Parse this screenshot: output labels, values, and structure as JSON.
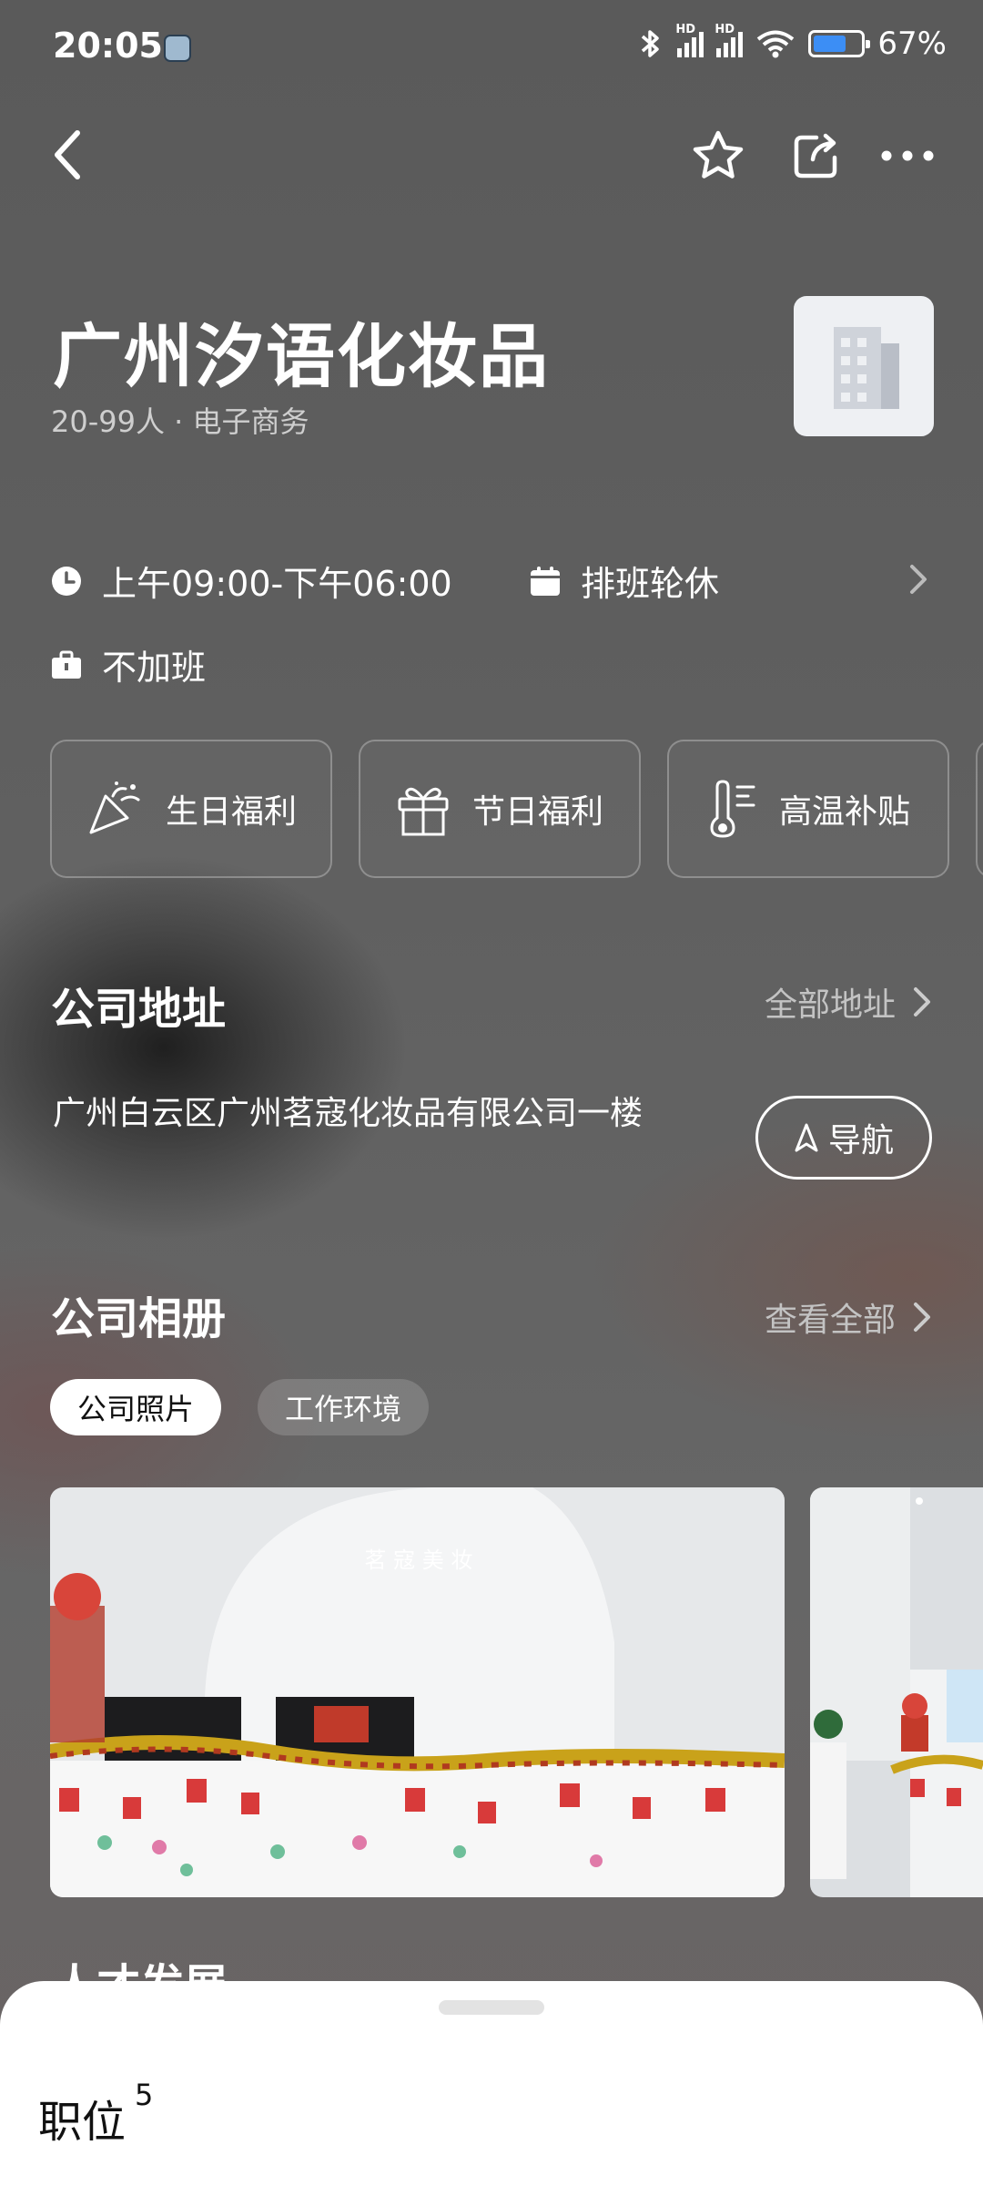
{
  "status_bar": {
    "time": "20:05",
    "battery": "67%",
    "battery_level": 0.67,
    "icons": [
      "alarm-app-icon",
      "bluetooth-icon",
      "signal-hd-icon",
      "signal-hd-icon",
      "wifi-icon",
      "battery-icon"
    ]
  },
  "header": {
    "back_icon": "chevron-left-icon",
    "actions": [
      "star-icon",
      "share-icon",
      "more-icon"
    ]
  },
  "company": {
    "name": "广州汐语化妆品",
    "meta": "20-99人 · 电子商务",
    "logo_icon": "building-icon"
  },
  "work_info": {
    "hours": "上午09:00-下午06:00",
    "schedule": "排班轮休",
    "overtime": "不加班"
  },
  "benefits": [
    {
      "label": "生日福利",
      "icon": "party-popper-icon"
    },
    {
      "label": "节日福利",
      "icon": "gift-icon"
    },
    {
      "label": "高温补贴",
      "icon": "thermometer-icon"
    }
  ],
  "address_section": {
    "title": "公司地址",
    "link": "全部地址",
    "address": "广州白云区广州茗寇化妆品有限公司一楼",
    "nav_button": "导航"
  },
  "album_section": {
    "title": "公司相册",
    "link": "查看全部",
    "tabs": [
      "公司照片",
      "工作环境"
    ],
    "active_tab": "公司照片",
    "photo_sign_text": "茗 寇 美 妆"
  },
  "next_section_title": "人才发展",
  "bottom_sheet": {
    "label": "职位",
    "count": "5"
  },
  "colors": {
    "accent_blue": "#3c8ef5",
    "sheet_bg": "#ffffff"
  }
}
